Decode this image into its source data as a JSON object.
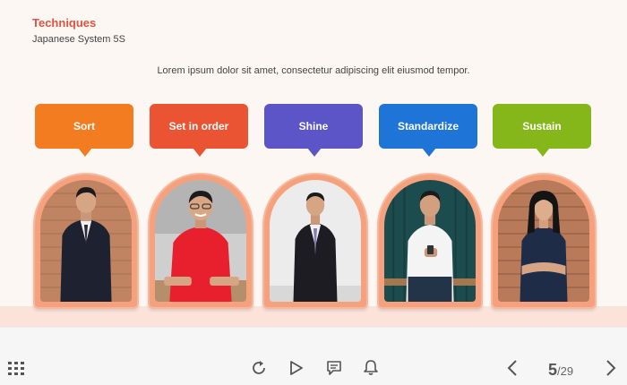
{
  "header": {
    "title": "Techniques",
    "subtitle": "Japanese System 5S"
  },
  "lead_text": "Lorem ipsum dolor sit amet, consectetur adipiscing elit eiusmod tempor.",
  "steps": [
    {
      "label": "Sort",
      "color": "#f47c20",
      "photo": "man-in-suit"
    },
    {
      "label": "Set in order",
      "color": "#eb5432",
      "photo": "man-in-red-shirt"
    },
    {
      "label": "Shine",
      "color": "#5b55c8",
      "photo": "man-in-dark-suit"
    },
    {
      "label": "Standardize",
      "color": "#1f74d8",
      "photo": "man-with-phone"
    },
    {
      "label": "Sustain",
      "color": "#86b71a",
      "photo": "woman-arms-crossed"
    }
  ],
  "toolbar": {
    "menu_icon": "grid-menu-icon",
    "replay_icon": "replay-icon",
    "play_icon": "play-icon",
    "comment_icon": "comment-icon",
    "bell_icon": "bell-icon",
    "prev_icon": "chevron-left-icon",
    "next_icon": "chevron-right-icon",
    "current_page": "5",
    "total_pages": "/29"
  }
}
